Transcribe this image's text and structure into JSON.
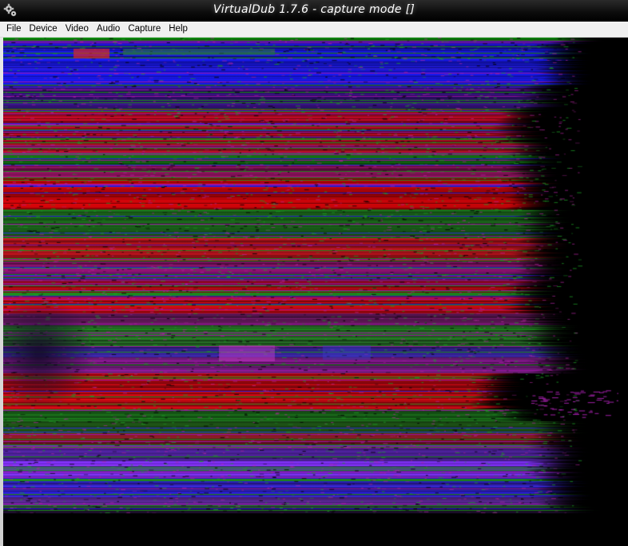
{
  "window": {
    "title": "VirtualDub 1.7.6 - capture mode []",
    "icon": "virtualdub-gear-icon"
  },
  "menu": {
    "items": [
      {
        "label": "File"
      },
      {
        "label": "Device"
      },
      {
        "label": "Video"
      },
      {
        "label": "Audio"
      },
      {
        "label": "Capture"
      },
      {
        "label": "Help"
      }
    ]
  },
  "preview": {
    "description_colors": {
      "red": "#c8001e",
      "blue": "#1a1aff",
      "green": "#0a7a10",
      "purple": "#7a30ff",
      "magenta": "#b01090",
      "black": "#000000"
    }
  }
}
